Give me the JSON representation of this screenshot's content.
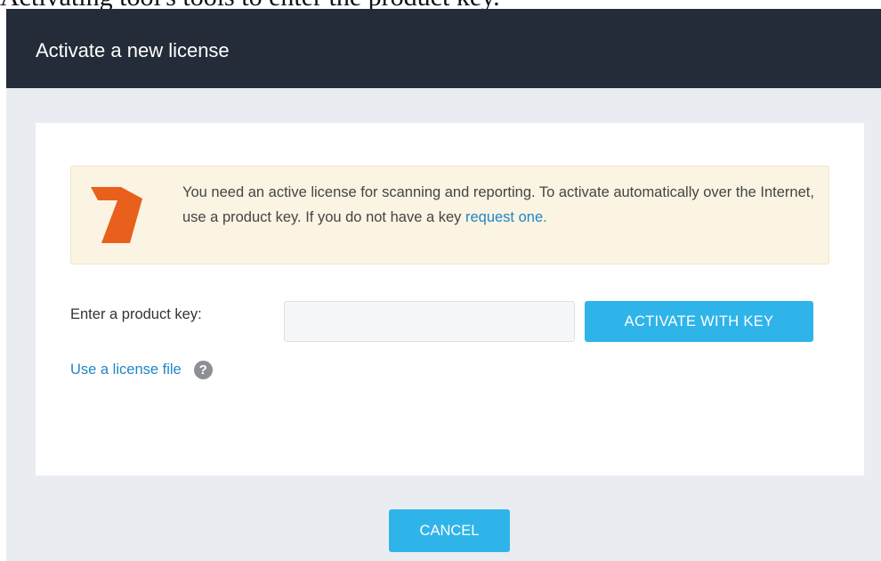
{
  "caption": {
    "text": "Activating tool's tools to enter the product key."
  },
  "dialog": {
    "title": "Activate a new license"
  },
  "notice": {
    "logo_icon": "rapid7-logo",
    "text": "You need an active license for scanning and reporting. To activate automatically over the Internet, use a product key. If you do not have a key ",
    "link_text": "request one.",
    "colors": {
      "background": "#fbf4e3",
      "logo": "#e8601c",
      "link": "#1f86c4"
    }
  },
  "product_key": {
    "label": "Enter a product key:",
    "value": "",
    "placeholder": "",
    "activate_label": "ACTIVATE WITH KEY"
  },
  "license_file": {
    "link_text": "Use a license file",
    "help_icon": "question-circle-icon"
  },
  "footer": {
    "cancel_label": "CANCEL"
  },
  "colors": {
    "header": "#232c38",
    "body": "#e9edf2",
    "accent": "#2fb4e9"
  }
}
